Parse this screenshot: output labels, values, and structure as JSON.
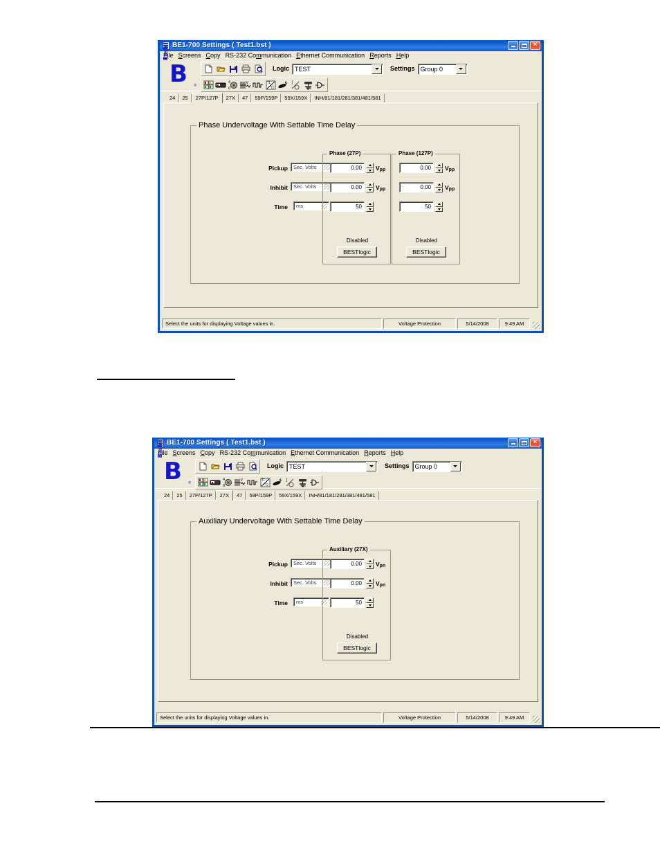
{
  "window1": {
    "title": "BE1-700 Settings   ( Test1.bst )",
    "title_icon": "application-icon",
    "menu": [
      {
        "label": "File",
        "accel": "F"
      },
      {
        "label": "Screens",
        "accel": "S"
      },
      {
        "label": "Copy",
        "accel": "C"
      },
      {
        "label": "RS-232 Communication",
        "accel": "m"
      },
      {
        "label": "Ethernet Communication",
        "accel": "E"
      },
      {
        "label": "Reports",
        "accel": "R"
      },
      {
        "label": "Help",
        "accel": "H"
      }
    ],
    "logo": {
      "word": "Basler",
      "mark": "B",
      "reg": "®"
    },
    "toolbar": {
      "file_buttons": [
        "new-icon",
        "open-icon",
        "save-icon",
        "print-icon",
        "print-preview-icon"
      ],
      "screen_buttons": [
        "general-settings-icon",
        "relay-device-icon",
        "global-settings-icon",
        "current-protection-icon",
        "pulse-logic-icon",
        "time-curve-icon",
        "breaker-monitor-icon",
        "io-icon",
        "ground-icon",
        "output-logic-icon"
      ],
      "logic_label": "Logic",
      "logic_value": "TEST",
      "settings_label": "Settings",
      "settings_value": "Group 0"
    },
    "tabs": [
      {
        "label": "24",
        "selected": false
      },
      {
        "label": "25",
        "selected": false
      },
      {
        "label": "27P/127P",
        "selected": true
      },
      {
        "label": "27X",
        "selected": false
      },
      {
        "label": "47",
        "selected": false
      },
      {
        "label": "59P/159P",
        "selected": false
      },
      {
        "label": "59X/159X",
        "selected": false
      },
      {
        "label": "INH/81/181/281/381/481/581",
        "selected": false
      }
    ],
    "group": {
      "legend": "Phase Undervoltage With Settable Time Delay",
      "row_labels": [
        "Pickup",
        "Inhibit",
        "Time"
      ],
      "unit_values": [
        "Sec. Volts",
        "Sec. Volts",
        "ms"
      ],
      "columns": [
        {
          "legend": "Phase (27P)",
          "values": [
            "0.00",
            "0.00",
            "50"
          ],
          "units": [
            "V",
            "V",
            ""
          ],
          "unit_sub": [
            "pp",
            "pp",
            ""
          ],
          "state": "Disabled",
          "button": "BESTlogic"
        },
        {
          "legend": "Phase (127P)",
          "values": [
            "0.00",
            "0.00",
            "50"
          ],
          "units": [
            "V",
            "V",
            ""
          ],
          "unit_sub": [
            "pp",
            "pp",
            ""
          ],
          "state": "Disabled",
          "button": "BESTlogic"
        }
      ]
    },
    "statusbar": {
      "hint": "Select the units for displaying Voltage values in.",
      "screen": "Voltage Protection",
      "date": "5/14/2008",
      "time": "9:49 AM"
    }
  },
  "window2": {
    "title": "BE1-700 Settings   ( Test1.bst )",
    "title_icon": "application-icon",
    "menu": [
      {
        "label": "File",
        "accel": "F"
      },
      {
        "label": "Screens",
        "accel": "S"
      },
      {
        "label": "Copy",
        "accel": "C"
      },
      {
        "label": "RS-232 Communication",
        "accel": "m"
      },
      {
        "label": "Ethernet Communication",
        "accel": "E"
      },
      {
        "label": "Reports",
        "accel": "R"
      },
      {
        "label": "Help",
        "accel": "H"
      }
    ],
    "logo": {
      "word": "Basler",
      "mark": "B",
      "reg": "®"
    },
    "toolbar": {
      "logic_label": "Logic",
      "logic_value": "TEST",
      "settings_label": "Settings",
      "settings_value": "Group 0"
    },
    "tabs": [
      {
        "label": "24",
        "selected": false
      },
      {
        "label": "25",
        "selected": false
      },
      {
        "label": "27P/127P",
        "selected": false
      },
      {
        "label": "27X",
        "selected": true
      },
      {
        "label": "47",
        "selected": false
      },
      {
        "label": "59P/159P",
        "selected": false
      },
      {
        "label": "59X/159X",
        "selected": false
      },
      {
        "label": "INH/81/181/281/381/481/581",
        "selected": false
      }
    ],
    "group": {
      "legend": "Auxiliary Undervoltage With Settable Time Delay",
      "row_labels": [
        "Pickup",
        "Inhibit",
        "Time"
      ],
      "unit_values": [
        "Sec. Volts",
        "Sec. Volts",
        "ms"
      ],
      "columns": [
        {
          "legend": "Auxiliary (27X)",
          "values": [
            "0.00",
            "0.00",
            "50"
          ],
          "units": [
            "V",
            "V",
            ""
          ],
          "unit_sub": [
            "pn",
            "pn",
            ""
          ],
          "state": "Disabled",
          "button": "BESTlogic"
        }
      ]
    },
    "statusbar": {
      "hint": "Select the units for displaying Voltage values in.",
      "screen": "Voltage Protection",
      "date": "5/14/2008",
      "time": "9:49 AM"
    }
  },
  "colors": {
    "title_blue": "#0a4fbe",
    "face": "#ece9d8",
    "logo_blue": "#1414c8",
    "close_red": "#e1462a"
  }
}
